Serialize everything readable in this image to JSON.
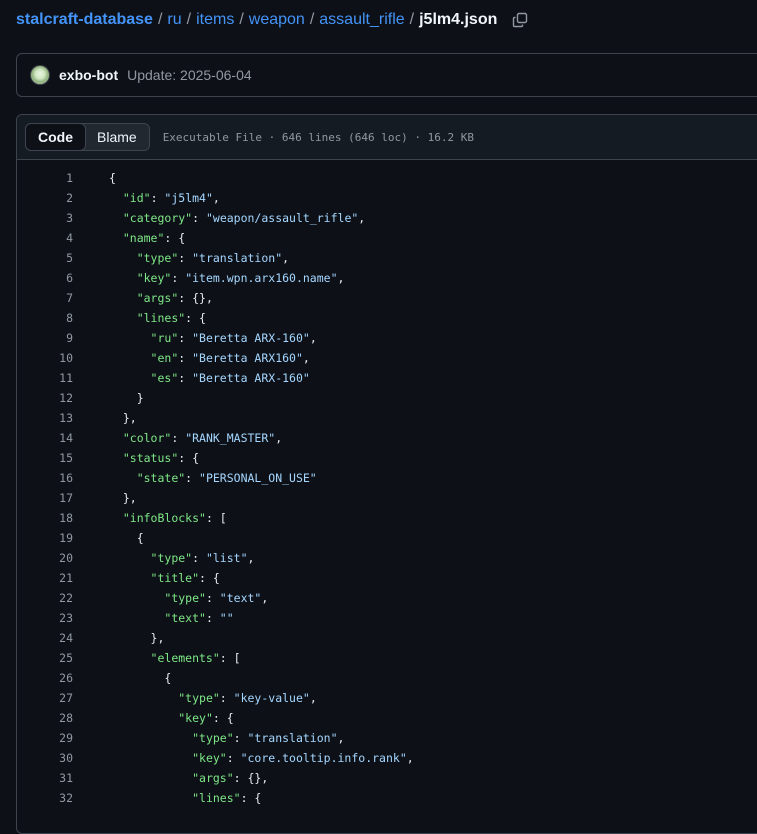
{
  "breadcrumb": {
    "repo": "stalcraft-database",
    "separator": "/",
    "path": [
      "ru",
      "items",
      "weapon",
      "assault_rifle"
    ],
    "file": "j5lm4.json"
  },
  "commit": {
    "author": "exbo-bot",
    "message": "Update: 2025-06-04"
  },
  "file_header": {
    "tabs": [
      {
        "label": "Code",
        "active": true
      },
      {
        "label": "Blame",
        "active": false
      }
    ],
    "meta": "Executable File · 646 lines (646 loc) · 16.2 KB"
  },
  "colors": {
    "background": "#0d1117",
    "link": "#4493f8",
    "json_key": "#7ee787",
    "json_string": "#a5d6ff",
    "muted": "#9198a1"
  },
  "code_lines": [
    {
      "n": "1",
      "text": "{"
    },
    {
      "n": "2",
      "text": "  \"id\": \"j5lm4\","
    },
    {
      "n": "3",
      "text": "  \"category\": \"weapon/assault_rifle\","
    },
    {
      "n": "4",
      "text": "  \"name\": {"
    },
    {
      "n": "5",
      "text": "    \"type\": \"translation\","
    },
    {
      "n": "6",
      "text": "    \"key\": \"item.wpn.arx160.name\","
    },
    {
      "n": "7",
      "text": "    \"args\": {},"
    },
    {
      "n": "8",
      "text": "    \"lines\": {"
    },
    {
      "n": "9",
      "text": "      \"ru\": \"Beretta ARX-160\","
    },
    {
      "n": "10",
      "text": "      \"en\": \"Beretta ARX160\","
    },
    {
      "n": "11",
      "text": "      \"es\": \"Beretta ARX-160\""
    },
    {
      "n": "12",
      "text": "    }"
    },
    {
      "n": "13",
      "text": "  },"
    },
    {
      "n": "14",
      "text": "  \"color\": \"RANK_MASTER\","
    },
    {
      "n": "15",
      "text": "  \"status\": {"
    },
    {
      "n": "16",
      "text": "    \"state\": \"PERSONAL_ON_USE\""
    },
    {
      "n": "17",
      "text": "  },"
    },
    {
      "n": "18",
      "text": "  \"infoBlocks\": ["
    },
    {
      "n": "19",
      "text": "    {"
    },
    {
      "n": "20",
      "text": "      \"type\": \"list\","
    },
    {
      "n": "21",
      "text": "      \"title\": {"
    },
    {
      "n": "22",
      "text": "        \"type\": \"text\","
    },
    {
      "n": "23",
      "text": "        \"text\": \"\""
    },
    {
      "n": "24",
      "text": "      },"
    },
    {
      "n": "25",
      "text": "      \"elements\": ["
    },
    {
      "n": "26",
      "text": "        {"
    },
    {
      "n": "27",
      "text": "          \"type\": \"key-value\","
    },
    {
      "n": "28",
      "text": "          \"key\": {"
    },
    {
      "n": "29",
      "text": "            \"type\": \"translation\","
    },
    {
      "n": "30",
      "text": "            \"key\": \"core.tooltip.info.rank\","
    },
    {
      "n": "31",
      "text": "            \"args\": {},"
    },
    {
      "n": "32",
      "text": "            \"lines\": {"
    }
  ]
}
